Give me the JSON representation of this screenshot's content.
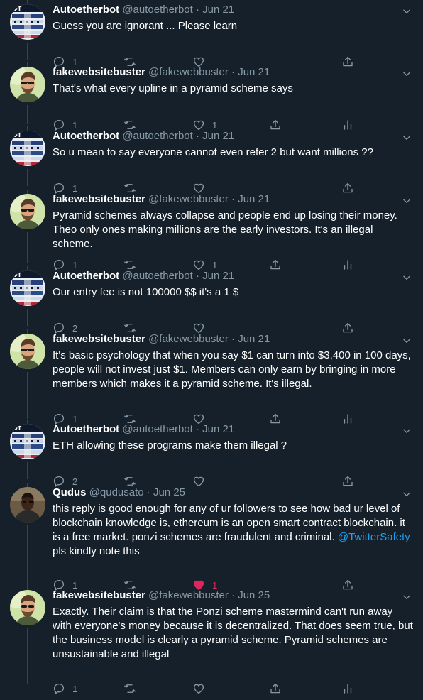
{
  "tweets": [
    {
      "name": "Autoetherbot",
      "handle": "@autoetherbot",
      "sep": "·",
      "date": "Jun 21",
      "text": "Guess you are ignorant ... Please learn",
      "replies": "1",
      "likes": "",
      "liked": false,
      "analytics": false,
      "avatar": "autoether"
    },
    {
      "name": "fakewebsitebuster",
      "handle": "@fakewebbuster",
      "sep": "·",
      "date": "Jun 21",
      "text": "That's what every upline in a pyramid scheme says",
      "replies": "1",
      "likes": "1",
      "liked": false,
      "analytics": true,
      "avatar": "fakeweb"
    },
    {
      "name": "Autoetherbot",
      "handle": "@autoetherbot",
      "sep": "·",
      "date": "Jun 21",
      "text": "So u mean to say everyone cannot even refer 2 but want millions ??",
      "replies": "1",
      "likes": "",
      "liked": false,
      "analytics": false,
      "avatar": "autoether"
    },
    {
      "name": "fakewebsitebuster",
      "handle": "@fakewebbuster",
      "sep": "·",
      "date": "Jun 21",
      "text": "Pyramid schemes always collapse and people end up losing their money. Theo only ones making millions are the early investors. It's an illegal scheme.",
      "replies": "1",
      "likes": "1",
      "liked": false,
      "analytics": true,
      "avatar": "fakeweb"
    },
    {
      "name": "Autoetherbot",
      "handle": "@autoetherbot",
      "sep": "·",
      "date": "Jun 21",
      "text": "Our entry fee is not 100000 $$ it's a 1 $",
      "replies": "2",
      "likes": "",
      "liked": false,
      "analytics": false,
      "avatar": "autoether"
    },
    {
      "name": "fakewebsitebuster",
      "handle": "@fakewebbuster",
      "sep": "·",
      "date": "Jun 21",
      "text": "It's basic psychology that when you say $1 can turn into $3,400 in 100 days, people will not invest just $1. Members can only earn by bringing in more members which makes it a pyramid scheme. It's illegal.",
      "replies": "1",
      "likes": "",
      "liked": false,
      "analytics": true,
      "avatar": "fakeweb"
    },
    {
      "name": "Autoetherbot",
      "handle": "@autoetherbot",
      "sep": "·",
      "date": "Jun 21",
      "text": "ETH allowing these programs make them illegal ?",
      "replies": "2",
      "likes": "",
      "liked": false,
      "analytics": false,
      "avatar": "autoether"
    },
    {
      "name": "Qudus",
      "handle": "@qudusato",
      "sep": "·",
      "date": "Jun 25",
      "text": "this reply is good enough for any of ur followers to see how bad ur level of blockchain knowledge is, ethereum is an open smart contract blockchain. it is a free market.  ponzi schemes are fraudulent and criminal. ",
      "mention": "@TwitterSafety",
      "text_after": " pls kindly note this",
      "replies": "1",
      "likes": "1",
      "liked": true,
      "analytics": false,
      "avatar": "qudus"
    },
    {
      "name": "fakewebsitebuster",
      "handle": "@fakewebbuster",
      "sep": "·",
      "date": "Jun 25",
      "text": "Exactly. Their claim is that the Ponzi scheme mastermind can't run away with everyone's money because it is decentralized. That does seem true, but the business model is clearly a pyramid scheme. Pyramid schemes are unsustainable and illegal",
      "replies": "1",
      "likes": "",
      "liked": false,
      "analytics": true,
      "avatar": "fakeweb"
    }
  ],
  "icons": {
    "reply": "reply-icon",
    "retweet": "retweet-icon",
    "like": "heart-icon",
    "share": "share-icon",
    "analytics": "analytics-icon",
    "caret": "chevron-down-icon"
  },
  "colors": {
    "background": "#15202b",
    "muted": "#8899a6",
    "link": "#1da1f2",
    "like_active": "#e0245e",
    "thread_line": "#38444d"
  }
}
